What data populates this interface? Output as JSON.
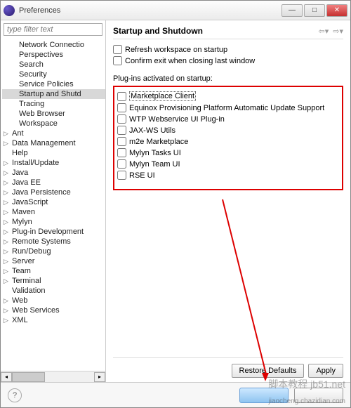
{
  "window": {
    "title": "Preferences"
  },
  "filter": {
    "placeholder": "type filter text"
  },
  "tree_children": [
    {
      "label": "Network Connectio"
    },
    {
      "label": "Perspectives"
    },
    {
      "label": "Search"
    },
    {
      "label": "Security"
    },
    {
      "label": "Service Policies"
    },
    {
      "label": "Startup and Shutd",
      "sel": true
    },
    {
      "label": "Tracing"
    },
    {
      "label": "Web Browser"
    },
    {
      "label": "Workspace"
    }
  ],
  "tree_top": [
    {
      "label": "Ant",
      "exp": true
    },
    {
      "label": "Data Management",
      "exp": true
    },
    {
      "label": "Help",
      "exp": false
    },
    {
      "label": "Install/Update",
      "exp": true
    },
    {
      "label": "Java",
      "exp": true
    },
    {
      "label": "Java EE",
      "exp": true
    },
    {
      "label": "Java Persistence",
      "exp": true
    },
    {
      "label": "JavaScript",
      "exp": true
    },
    {
      "label": "Maven",
      "exp": true
    },
    {
      "label": "Mylyn",
      "exp": true
    },
    {
      "label": "Plug-in Development",
      "exp": true
    },
    {
      "label": "Remote Systems",
      "exp": true
    },
    {
      "label": "Run/Debug",
      "exp": true
    },
    {
      "label": "Server",
      "exp": true
    },
    {
      "label": "Team",
      "exp": true
    },
    {
      "label": "Terminal",
      "exp": true
    },
    {
      "label": "Validation",
      "exp": false
    },
    {
      "label": "Web",
      "exp": true
    },
    {
      "label": "Web Services",
      "exp": true
    },
    {
      "label": "XML",
      "exp": true
    }
  ],
  "page": {
    "title": "Startup and Shutdown",
    "refresh": "Refresh workspace on startup",
    "confirm": "Confirm exit when closing last window",
    "plugins_label": "Plug-ins activated on startup:"
  },
  "plugins": [
    {
      "label": "Marketplace Client",
      "hl": true
    },
    {
      "label": "Equinox Provisioning Platform Automatic Update Support"
    },
    {
      "label": "WTP Webservice UI Plug-in"
    },
    {
      "label": "JAX-WS Utils"
    },
    {
      "label": "m2e Marketplace"
    },
    {
      "label": "Mylyn Tasks UI"
    },
    {
      "label": "Mylyn Team UI"
    },
    {
      "label": "RSE UI"
    }
  ],
  "buttons": {
    "restore": "Restore Defaults",
    "apply": "Apply"
  },
  "watermark": {
    "main": "脚本教程 jb51.net",
    "sub": "jiaocheng.chazidian.com"
  }
}
